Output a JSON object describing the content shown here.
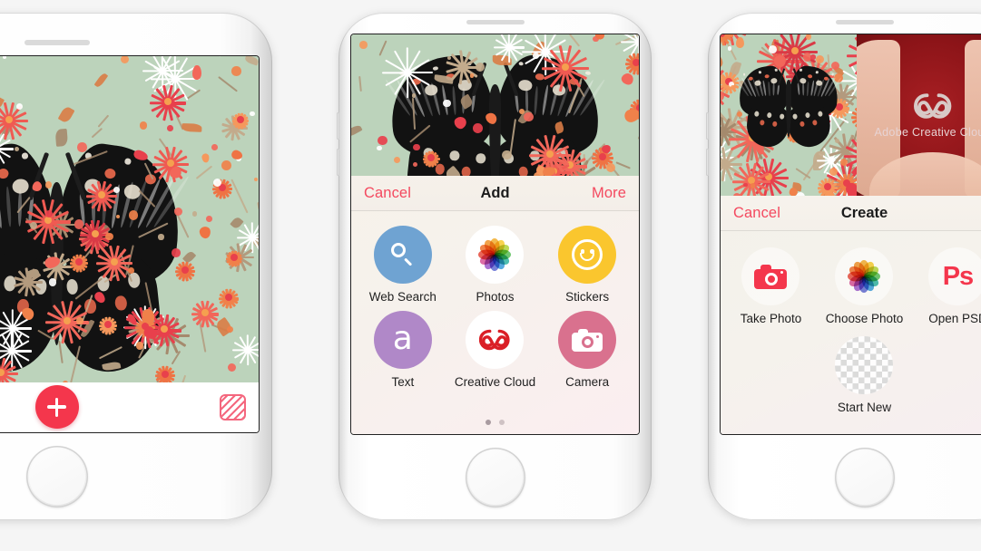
{
  "meta": {
    "scene": "Three iPhones showing Adobe Photoshop Mix / Comp style app screens"
  },
  "colors": {
    "accent_red": "#f4364c",
    "sheet_action_red": "#f4495f",
    "web_search_blue": "#6fa3d2",
    "stickers_yellow": "#fac62e",
    "text_purple": "#b088c8",
    "camera_pink": "#d9718e",
    "creative_cloud_red": "#da1f26",
    "wallpaper_green": "#bcd3bb"
  },
  "phone_left": {
    "name": "editor-screen",
    "toolbar": {
      "crop_icon": "crop-icon",
      "add_button_icon": "plus-icon",
      "pattern_icon": "hatch-pattern-icon"
    },
    "canvas_alt": "butterfly-on-floral-pattern"
  },
  "phone_middle": {
    "name": "add-sheet-screen",
    "sheet": {
      "cancel_label": "Cancel",
      "title": "Add",
      "more_label": "More",
      "items": [
        {
          "label": "Web Search",
          "icon": "search-icon",
          "style": "blue"
        },
        {
          "label": "Photos",
          "icon": "photos-flower-icon",
          "style": "white"
        },
        {
          "label": "Stickers",
          "icon": "smiley-icon",
          "style": "yellow"
        },
        {
          "label": "Text",
          "icon": "letter-a-icon",
          "style": "purple"
        },
        {
          "label": "Creative Cloud",
          "icon": "creative-cloud-icon",
          "style": "white"
        },
        {
          "label": "Camera",
          "icon": "camera-icon",
          "style": "pink"
        }
      ],
      "page_dots": {
        "count": 2,
        "active_index": 0
      }
    }
  },
  "phone_right": {
    "name": "create-sheet-screen",
    "gallery": {
      "card_title": "Adobe Creative Cloud"
    },
    "sheet": {
      "cancel_label": "Cancel",
      "title": "Create",
      "items": [
        {
          "label": "Take Photo",
          "icon": "camera-icon",
          "style": "light"
        },
        {
          "label": "Choose Photo",
          "icon": "photos-flower-icon",
          "style": "light"
        },
        {
          "label": "Open PSD",
          "icon": "photoshop-ps-icon",
          "style": "light",
          "glyph": "Ps"
        },
        {
          "label": "Start New",
          "icon": "transparency-checker-icon",
          "style": "checker"
        }
      ]
    }
  }
}
